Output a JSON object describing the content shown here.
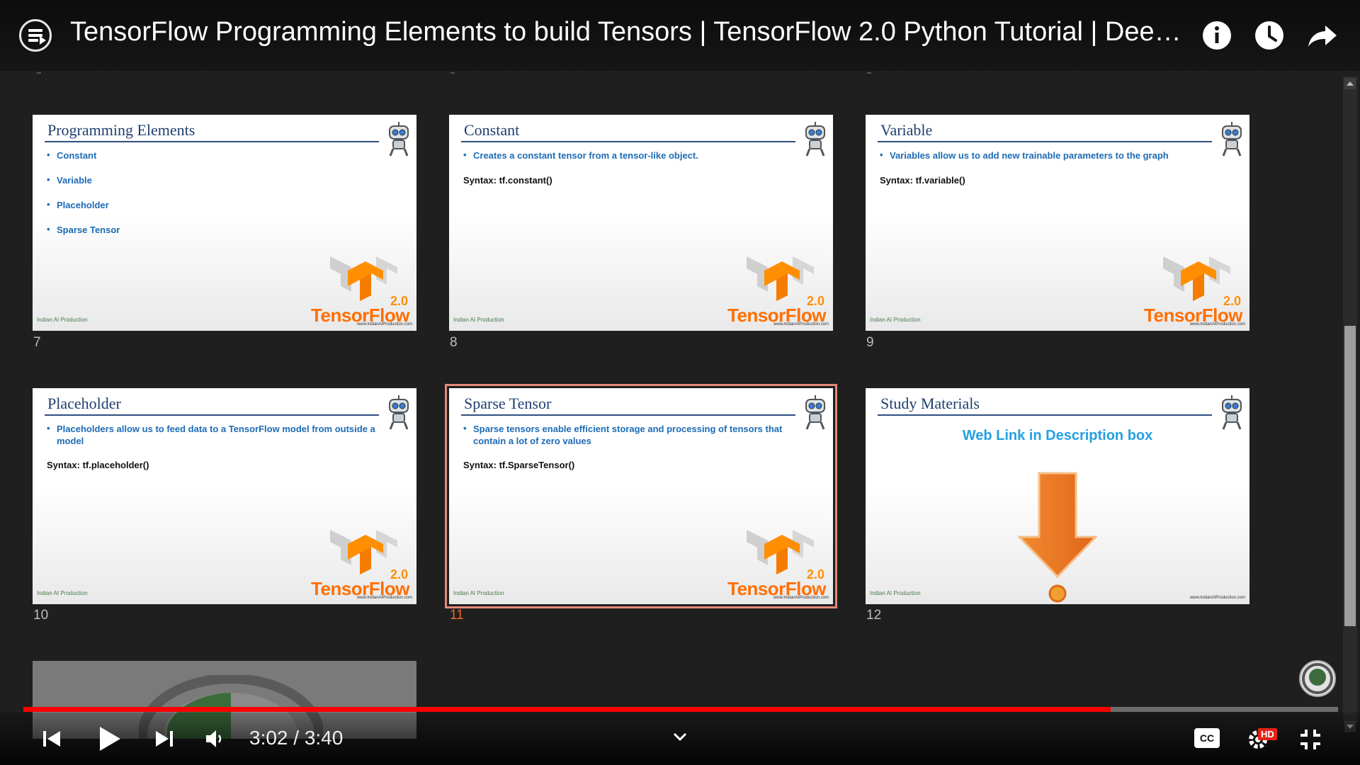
{
  "header": {
    "title": "TensorFlow Programming Elements to build Tensors | TensorFlow 2.0 Python Tutorial | Deep le...",
    "icons": [
      "playlist-icon",
      "info-icon",
      "watch-later-icon",
      "share-icon"
    ]
  },
  "slides": [
    {
      "number": "7",
      "title": "Programming Elements",
      "bullets": [
        "Constant",
        "Variable",
        "Placeholder",
        "Sparse Tensor"
      ],
      "syntax": "",
      "tf_word": "TensorFlow",
      "tf_version": "2.0",
      "brand_left": "Indian AI Production",
      "brand_right": "www.IndianAIProduction.com"
    },
    {
      "number": "8",
      "title": "Constant",
      "bullets": [
        "Creates a constant tensor from a tensor-like object."
      ],
      "syntax": "Syntax: tf.constant()",
      "tf_word": "TensorFlow",
      "tf_version": "2.0",
      "brand_left": "Indian AI Production",
      "brand_right": "www.IndianAIProduction.com"
    },
    {
      "number": "9",
      "title": "Variable",
      "bullets": [
        "Variables allow us to add new trainable parameters to the graph"
      ],
      "syntax": "Syntax: tf.variable()",
      "tf_word": "TensorFlow",
      "tf_version": "2.0",
      "brand_left": "Indian AI Production",
      "brand_right": "www.IndianAIProduction.com"
    },
    {
      "number": "10",
      "title": "Placeholder",
      "bullets": [
        "Placeholders allow us to feed data to a TensorFlow model from outside a model"
      ],
      "syntax": "Syntax: tf.placeholder()",
      "tf_word": "TensorFlow",
      "tf_version": "2.0",
      "brand_left": "Indian AI Production",
      "brand_right": "www.IndianAIProduction.com"
    },
    {
      "number": "11",
      "title": "Sparse Tensor",
      "bullets": [
        "Sparse tensors enable efficient storage and processing of tensors that contain a lot of zero values"
      ],
      "syntax": "Syntax: tf.SparseTensor()",
      "tf_word": "TensorFlow",
      "tf_version": "2.0",
      "brand_left": "Indian AI Production",
      "brand_right": "www.IndianAIProduction.com",
      "selected": true
    },
    {
      "number": "12",
      "title": "Study Materials",
      "bullets": [],
      "syntax": "",
      "web_link": "Web Link in Description box",
      "brand_left": "Indian AI Production",
      "brand_right": "www.IndianAIProduction.com"
    }
  ],
  "player": {
    "current_time": "3:02",
    "duration": "3:40",
    "time_display": "3:02 / 3:40",
    "progress_fraction": 0.8273,
    "quality_badge": "HD",
    "cc_label": "CC",
    "colors": {
      "progress": "#ff0000",
      "selected_slide_border": "#e4897a",
      "active_number": "#e86b2a"
    }
  }
}
